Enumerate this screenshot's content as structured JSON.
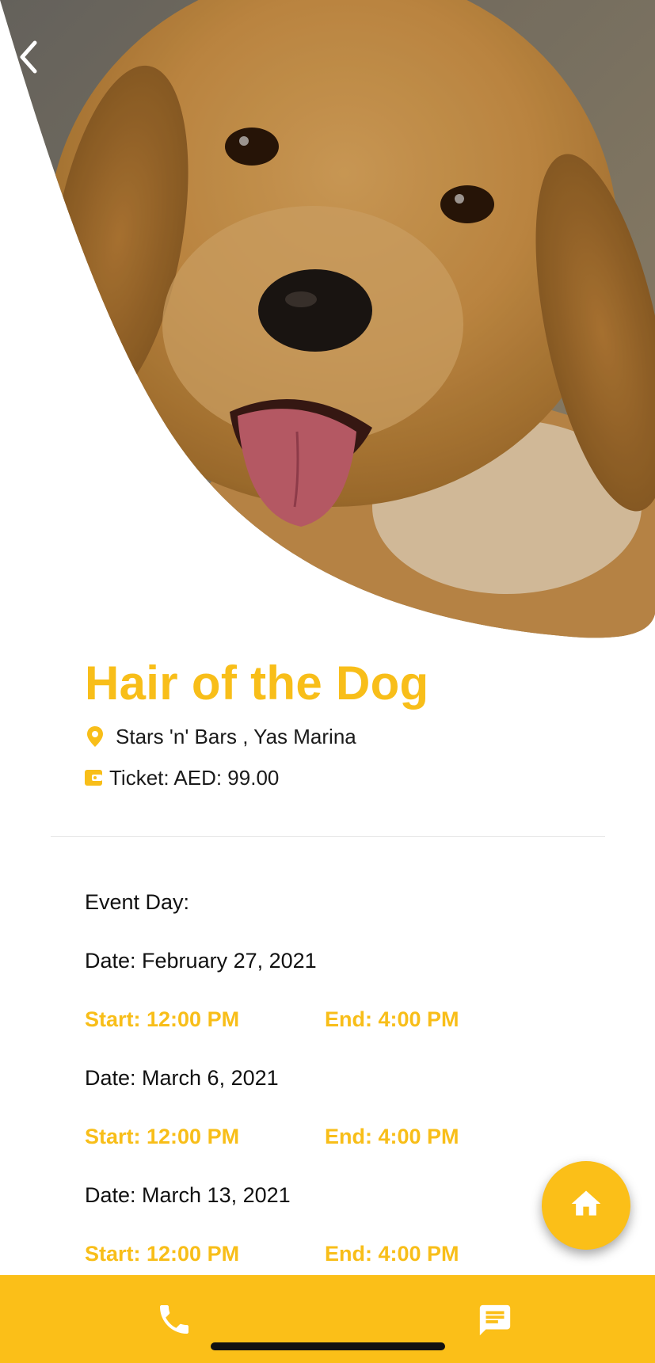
{
  "event": {
    "title": "Hair of the Dog",
    "location": "Stars 'n' Bars , Yas Marina",
    "ticket": "Ticket: AED: 99.00"
  },
  "schedule": {
    "heading": "Event Day:",
    "items": [
      {
        "date": "Date: February 27, 2021",
        "start": "Start: 12:00 PM",
        "end": "End: 4:00 PM"
      },
      {
        "date": "Date: March 6, 2021",
        "start": "Start: 12:00 PM",
        "end": "End: 4:00 PM"
      },
      {
        "date": "Date: March 13, 2021",
        "start": "Start: 12:00 PM",
        "end": "End: 4:00 PM"
      }
    ]
  },
  "icons": {
    "back": "chevron-left-icon",
    "location": "location-pin-icon",
    "ticket": "wallet-icon",
    "home": "home-icon",
    "phone": "phone-icon",
    "chat": "chat-icon"
  },
  "colors": {
    "accent": "#F8BE19",
    "bottom_bar": "#FBBF18",
    "text": "#111111"
  }
}
